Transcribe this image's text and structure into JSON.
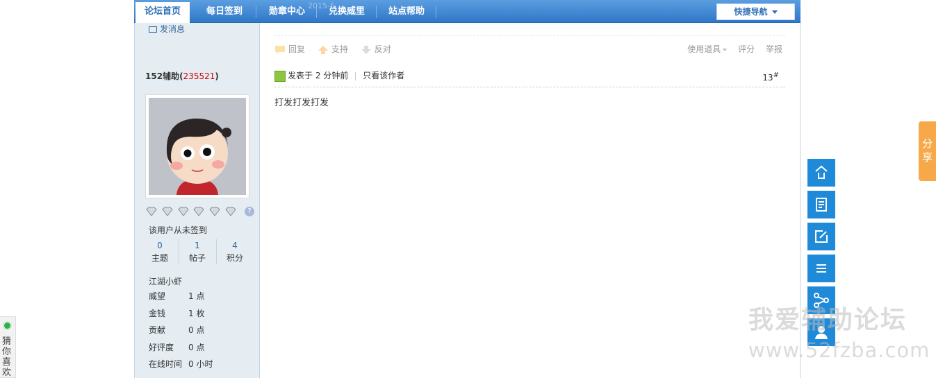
{
  "nav": {
    "tabs": [
      {
        "label": "论坛首页",
        "active": true
      },
      {
        "label": "每日签到",
        "active": false
      },
      {
        "label": "勋章中心",
        "active": false
      },
      {
        "label": "兑换威里",
        "active": false
      },
      {
        "label": "站点帮助",
        "active": false
      }
    ],
    "quick_nav_label": "快捷导航",
    "ghost_text": "2015-5"
  },
  "user": {
    "send_message": "发消息",
    "name": "152辅助",
    "uid": "235521",
    "not_signed": "该用户从未签到",
    "stats": [
      {
        "value": "0",
        "label": "主题"
      },
      {
        "value": "1",
        "label": "帖子"
      },
      {
        "value": "4",
        "label": "积分"
      }
    ],
    "rank": "江湖小虾",
    "profile": [
      {
        "key": "威望",
        "value": "1 点"
      },
      {
        "key": "金钱",
        "value": "1 枚"
      },
      {
        "key": "贡献",
        "value": "0 点"
      },
      {
        "key": "好评度",
        "value": "0 点"
      },
      {
        "key": "在线时间",
        "value": "0 小时"
      }
    ]
  },
  "post": {
    "actions": [
      "回复",
      "支持",
      "反对"
    ],
    "tools": [
      "使用道具",
      "评分",
      "举报"
    ],
    "posted": "发表于 2 分钟前",
    "only_author": "只看该作者",
    "floor": "13",
    "floor_mark": "#",
    "content": "打发打发打发"
  },
  "share_tab": [
    "分",
    "享"
  ],
  "side_buttons": [
    "back-to-top-icon",
    "document-icon",
    "edit-icon",
    "list-icon",
    "share-icon",
    "user-icon"
  ],
  "watermark": {
    "line1": "我爱辅助论坛",
    "line2": "www.52fzba.com"
  },
  "guess": "猜你喜欢",
  "colors": {
    "nav_blue": "#2f78c8",
    "side_blue": "#1e8ad8",
    "share_orange": "#f7a94a",
    "panel_bg": "#e5edf2"
  }
}
